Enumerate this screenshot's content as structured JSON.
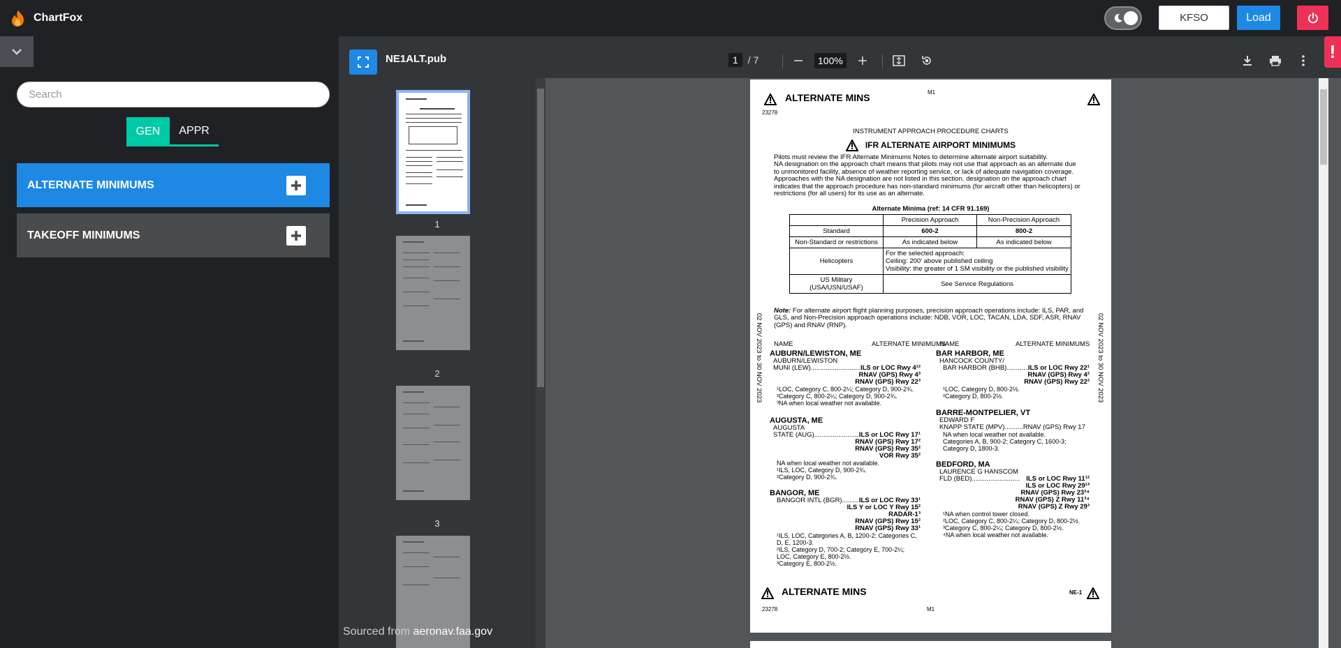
{
  "app": {
    "name": "ChartFox"
  },
  "header": {
    "icao_value": "KFSO",
    "load_label": "Load"
  },
  "sidebar": {
    "search_placeholder": "Search",
    "tabs": [
      {
        "label": "GEN"
      },
      {
        "label": "APPR"
      }
    ],
    "categories": [
      {
        "label": "ALTERNATE MINIMUMS"
      },
      {
        "label": "TAKEOFF MINIMUMS"
      }
    ]
  },
  "viewer": {
    "filename": "NE1ALT.pub",
    "current_page": "1",
    "page_count": "/ 7",
    "zoom": "100%",
    "thumbnails": [
      {
        "num": "1"
      },
      {
        "num": "2"
      },
      {
        "num": "3"
      }
    ],
    "alert": "!",
    "source_prefix": "Sourced from",
    "source_domain": "aeronav.faa.gov"
  },
  "doc": {
    "title": "ALTERNATE MINS",
    "m1": "M1",
    "code": "23278",
    "section": "INSTRUMENT APPROACH PROCEDURE CHARTS",
    "heading": "IFR ALTERNATE AIRPORT MINIMUMS",
    "intro": [
      "Pilots must review the IFR Alternate Minimums Notes to determine alternate airport suitability.",
      "NA designation on the approach chart means that pilots may not use that approach as an alternate due",
      "to unmonitored facility, absence of weather reporting service, or lack of adequate navigation coverage.",
      "Approaches with the NA designation are not listed in this section. designation on the approach chart",
      "indicates that the approach procedure has non-standard minimums (for aircraft other than helicopters) or",
      "restrictions (for all users) for its use as an alternate."
    ],
    "minima_title": "Alternate Minima (ref: 14 CFR 91.169)",
    "table": {
      "h1": "Precision Approach",
      "h2": "Non-Precision Approach",
      "r1": [
        "Standard",
        "600-2",
        "800-2"
      ],
      "r2": [
        "Non-Standard or restrictions",
        "As indicated below",
        "As indicated below"
      ],
      "r3_label": "Helicopters",
      "r3_lines": [
        "For the selected approach:",
        "Ceiling: 200' above published ceiling",
        "Visibility: the greater of 1 SM visibility or the published visibility"
      ],
      "r4_label": [
        "US Military",
        "(USA/USN/USAF)"
      ],
      "r4_val": "See Service Regulations"
    },
    "note_label": "Note:",
    "note": [
      "For alternate airport flight planning purposes, precision approach operations include: ILS, PAR, and",
      "GLS, and Non-Precision approach operations include: NDB, VOR, LOC, TACAN, LDA, SDF, ASR, RNAV",
      "(GPS) and RNAV (RNP)."
    ],
    "col_name": "NAME",
    "col_mins": "ALTERNATE MINIMUMS",
    "effective_left": "02 NOV 2023  to  30 NOV 2023",
    "effective_right": "02 NOV 2023  to  30 NOV 2023",
    "footer_title": "ALTERNATE MINS",
    "footer_code": "NE-1",
    "footer_num": "23278",
    "footer_m1": "M1",
    "left_entries": [
      {
        "name": "AUBURN/LEWISTON, ME",
        "sub": [
          "AUBURN/LEWISTON",
          "MUNI (LEW)..........................."
        ],
        "procs": [
          "ILS or LOC Rwy 4¹²",
          "RNAV (GPS) Rwy 4³",
          "RNAV (GPS) Rwy 22³"
        ],
        "notes": [
          "¹LOC, Category C, 800-2¼; Category D, 900-2¾.",
          "²Category C, 800-2¼; Category D, 900-2¾.",
          "³NA when local weather not available."
        ]
      },
      {
        "name": "AUGUSTA, ME",
        "sub": [
          "AUGUSTA",
          "STATE (AUG)........................."
        ],
        "procs": [
          "ILS or LOC Rwy 17¹",
          "RNAV (GPS) Rwy 17²",
          "RNAV (GPS) Rwy 35²",
          "VOR Rwy 35²"
        ],
        "notes": [
          "NA when local weather not available.",
          "¹ILS, LOC, Category D, 900-2¾.",
          "²Category D, 900-2¾."
        ]
      },
      {
        "name": "BANGOR, ME",
        "sub": [
          "BANGOR INTL (BGR).........."
        ],
        "procs": [
          "ILS or LOC Rwy 33¹",
          "ILS Y or LOC Y Rwy 15²",
          "RADAR-1³",
          "RNAV (GPS) Rwy 15²",
          "RNAV (GPS) Rwy 33¹"
        ],
        "notes": [
          "¹ILS, LOC, Categories A, B, 1200-2; Categories C,",
          "  D, E, 1200-3.",
          "²ILS, Category D, 700-2; Category E, 700-2¼;",
          "  LOC, Category E, 800-2½.",
          "³Category E, 800-2½."
        ]
      }
    ],
    "right_entries": [
      {
        "name": "BAR HARBOR, ME",
        "sub": [
          "HANCOCK COUNTY/",
          "BAR HARBOR (BHB)..........."
        ],
        "procs": [
          "ILS or LOC Rwy 22¹",
          "RNAV (GPS) Rwy 4²",
          "RNAV (GPS) Rwy 22²"
        ],
        "notes": [
          "¹LOC, Category D, 800-2½.",
          "²Category D, 800-2½."
        ]
      },
      {
        "name": "BARRE-MONTPELIER, VT",
        "sub": [
          "EDWARD F",
          "KNAPP STATE (MPV)..........RNAV (GPS) Rwy 17"
        ],
        "procs": [],
        "notes": [
          "NA when local weather not available.",
          "Categories A, B, 900-2; Category C, 1600-3;",
          "  Category D, 1800-3."
        ]
      },
      {
        "name": "BEDFORD, MA",
        "sub": [
          "LAURENCE G HANSCOM",
          "FLD (BED).........................."
        ],
        "procs": [
          "ILS or LOC Rwy 11¹²",
          "ILS or LOC Rwy 29¹³",
          "RNAV (GPS)  Rwy 23³⁴",
          "RNAV (GPS) Z Rwy 11³⁴",
          "RNAV (GPS) Z Rwy 29³"
        ],
        "notes": [
          "¹NA when control tower closed.",
          "²LOC, Category C, 800-2¼; Category D, 800-2½.",
          "³Category C, 800-2¼; Category D, 800-2½.",
          "⁴NA when local weather not available."
        ]
      }
    ]
  }
}
